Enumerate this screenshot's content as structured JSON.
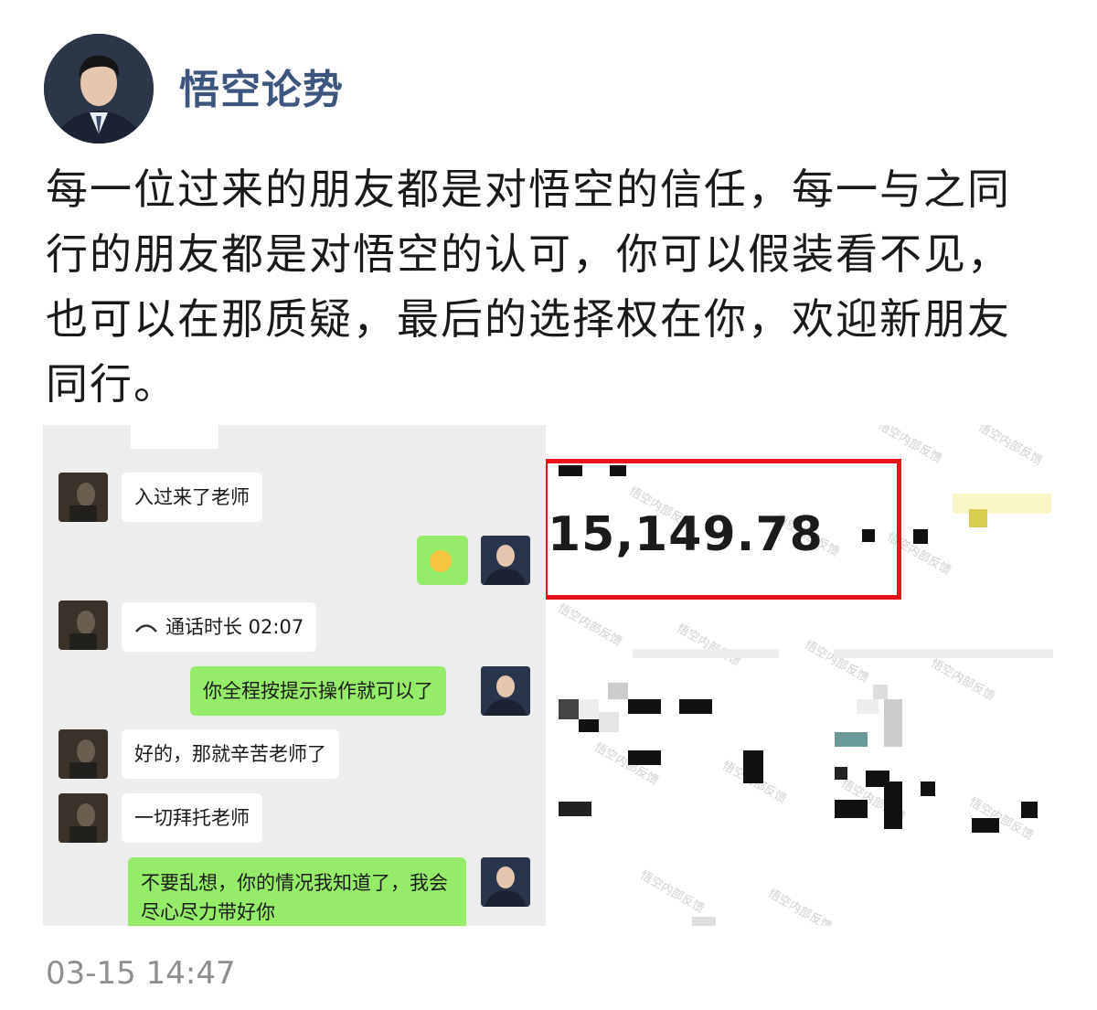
{
  "author": {
    "name": "悟空论势"
  },
  "post": {
    "text": "每一位过来的朋友都是对悟空的信任，每一与之同行的朋友都是对悟空的认可，你可以假装看不见，也可以在那质疑，最后的选择权在你，欢迎新朋友同行。",
    "timestamp": "03-15 14:47"
  },
  "chat": {
    "messages": [
      {
        "side": "left",
        "text": "入过来了老师"
      },
      {
        "side": "right",
        "icon": "ok-hand-emoji"
      },
      {
        "side": "left",
        "icon": "phone-icon",
        "text": "通话时长 02:07"
      },
      {
        "side": "right",
        "text": "你全程按提示操作就可以了"
      },
      {
        "side": "left",
        "text": "好的，那就辛苦老师了"
      },
      {
        "side": "left",
        "text": "一切拜托老师"
      },
      {
        "side": "right",
        "text": "不要乱想，你的情况我知道了，我会尽心尽力带好你"
      }
    ]
  },
  "screenshot": {
    "amount": "15,149.78",
    "watermark": "悟空内部反馈",
    "highlight_color": "#e8141c"
  }
}
